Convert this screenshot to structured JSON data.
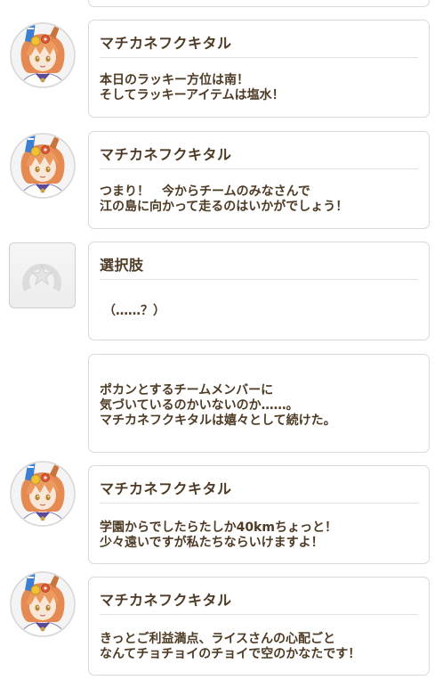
{
  "entries": [
    {
      "type": "dialogue",
      "speaker": "マチカネフクキタル",
      "text": "本日のラッキー方位は南！\nそしてラッキーアイテムは塩水！",
      "avatar_icon": "character-portrait-icon"
    },
    {
      "type": "dialogue",
      "speaker": "マチカネフクキタル",
      "text": "つまり！　今からチームのみなさんで\n江の島に向かって走るのはいかがでしょう！",
      "avatar_icon": "character-portrait-icon"
    },
    {
      "type": "choice",
      "speaker": "選択肢",
      "text": "（……？）",
      "avatar_icon": "horseshoe-star-icon"
    },
    {
      "type": "narration",
      "text": "ポカンとするチームメンバーに\n気づいているのかいないのか……。\nマチカネフクキタルは嬉々として続けた。"
    },
    {
      "type": "dialogue",
      "speaker": "マチカネフクキタル",
      "text": "学園からでしたらたしか40kmちょっと！\n少々遠いですが私たちならいけますよ！",
      "avatar_icon": "character-portrait-icon"
    },
    {
      "type": "dialogue",
      "speaker": "マチカネフクキタル",
      "text": "きっとご利益満点、ライスさんの心配ごと\nなんてチョチョイのチョイで空のかなたです！",
      "avatar_icon": "character-portrait-icon"
    }
  ],
  "colors": {
    "text": "#4e3b25",
    "card_border": "#d9d9d9",
    "hair": "#e58a52",
    "ribbon_blue": "#3b7fd4"
  }
}
